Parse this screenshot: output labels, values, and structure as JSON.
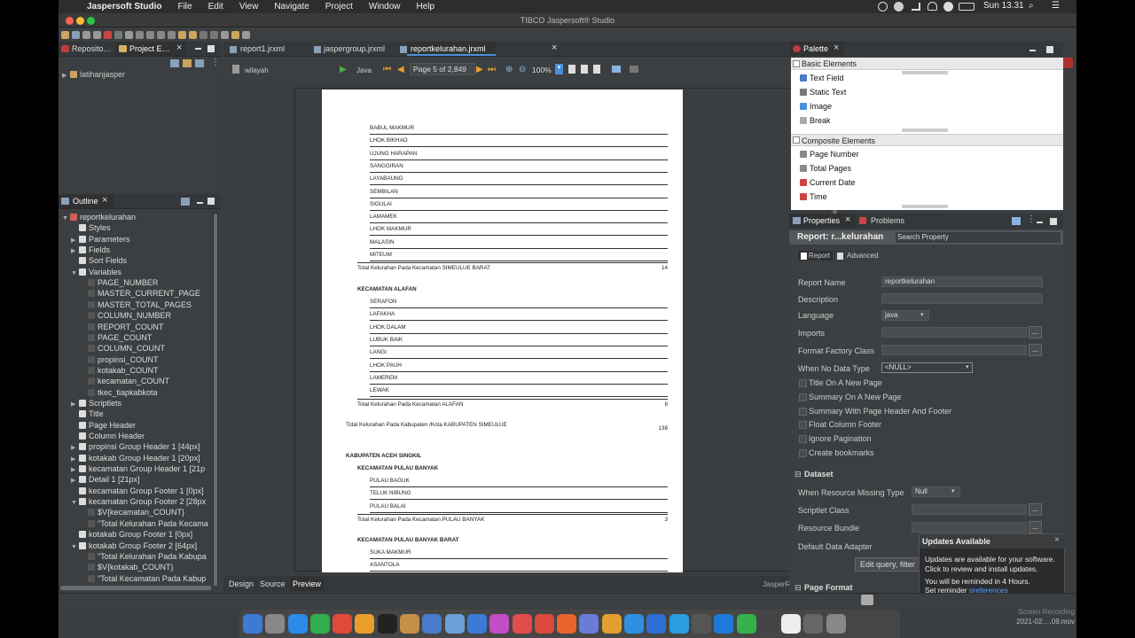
{
  "menubar": {
    "app": "Jaspersoft Studio",
    "items": [
      "File",
      "Edit",
      "View",
      "Navigate",
      "Project",
      "Window",
      "Help"
    ],
    "clock": "Sun 13.31"
  },
  "window_title": "TIBCO Jaspersoft® Studio",
  "left_tabs": {
    "repo": "Reposito…",
    "project": "Project E…"
  },
  "project_tree": {
    "root": "latihanjasper"
  },
  "outline": {
    "tab": "Outline",
    "items": [
      {
        "label": "reportkelurahan",
        "level": 0,
        "arrow": "▼"
      },
      {
        "label": "Styles",
        "level": 1,
        "arrow": ""
      },
      {
        "label": "Parameters",
        "level": 1,
        "arrow": "▶"
      },
      {
        "label": "Fields",
        "level": 1,
        "arrow": "▶"
      },
      {
        "label": "Sort Fields",
        "level": 1,
        "arrow": ""
      },
      {
        "label": "Variables",
        "level": 1,
        "arrow": "▼"
      },
      {
        "label": "PAGE_NUMBER",
        "level": 2,
        "arrow": ""
      },
      {
        "label": "MASTER_CURRENT_PAGE",
        "level": 2,
        "arrow": ""
      },
      {
        "label": "MASTER_TOTAL_PAGES",
        "level": 2,
        "arrow": ""
      },
      {
        "label": "COLUMN_NUMBER",
        "level": 2,
        "arrow": ""
      },
      {
        "label": "REPORT_COUNT",
        "level": 2,
        "arrow": ""
      },
      {
        "label": "PAGE_COUNT",
        "level": 2,
        "arrow": ""
      },
      {
        "label": "COLUMN_COUNT",
        "level": 2,
        "arrow": ""
      },
      {
        "label": "propinsi_COUNT",
        "level": 2,
        "arrow": ""
      },
      {
        "label": "kotakab_COUNT",
        "level": 2,
        "arrow": ""
      },
      {
        "label": "kecamatan_COUNT",
        "level": 2,
        "arrow": ""
      },
      {
        "label": "tkec_tiapkabkota",
        "level": 2,
        "arrow": ""
      },
      {
        "label": "Scriptlets",
        "level": 1,
        "arrow": "▶"
      },
      {
        "label": "Title",
        "level": 1,
        "arrow": ""
      },
      {
        "label": "Page Header",
        "level": 1,
        "arrow": ""
      },
      {
        "label": "Column Header",
        "level": 1,
        "arrow": ""
      },
      {
        "label": "propinsi Group Header 1 [44px]",
        "level": 1,
        "arrow": "▶"
      },
      {
        "label": "kotakab Group Header 1 [20px]",
        "level": 1,
        "arrow": "▶"
      },
      {
        "label": "kecamatan Group Header 1 [21p",
        "level": 1,
        "arrow": "▶"
      },
      {
        "label": "Detail 1 [21px]",
        "level": 1,
        "arrow": "▶"
      },
      {
        "label": "kecamatan Group Footer 1 [0px]",
        "level": 1,
        "arrow": ""
      },
      {
        "label": "kecamatan Group Footer 2 [28px",
        "level": 1,
        "arrow": "▼"
      },
      {
        "label": "$V{kecamatan_COUNT}",
        "level": 2,
        "arrow": ""
      },
      {
        "label": "\"Total Kelurahan Pada Kecama",
        "level": 2,
        "arrow": ""
      },
      {
        "label": "kotakab Group Footer 1 [0px]",
        "level": 1,
        "arrow": ""
      },
      {
        "label": "kotakab Group Footer 2 [64px]",
        "level": 1,
        "arrow": "▼"
      },
      {
        "label": "\"Total Kelurahan Pada Kabupa",
        "level": 2,
        "arrow": ""
      },
      {
        "label": "$V{kotakab_COUNT}",
        "level": 2,
        "arrow": ""
      },
      {
        "label": "\"Total Kecamatan Pada Kabup",
        "level": 2,
        "arrow": ""
      }
    ]
  },
  "editor": {
    "tabs": [
      "report1.jrxml",
      "jaspergroup.jrxml",
      "reportkelurahan.jrxml"
    ],
    "dataset": "wilayah",
    "language": "Java",
    "page_indicator": "Page 5 of 2,849",
    "zoom": "100%",
    "bottom_tabs": [
      "Design",
      "Source",
      "Preview"
    ],
    "library": "JasperReports Library"
  },
  "report": {
    "group1_rows": [
      "BABUL MAKMUR",
      "LHOK BIKHAO",
      "UJUNG HARAPAN",
      "SANGGIRAN",
      "LAYABAUNG",
      "SEMBILAN",
      "SIGULAI",
      "LAMAMEK",
      "LHOK MAKMUR",
      "MALASIN",
      "MITEUM"
    ],
    "total1": "Total Kelurahan Pada Kecamatan SIMEULUE BARAT",
    "total1_n": "14",
    "kec2": "KECAMATAN ALAFAN",
    "group2_rows": [
      "SERAFON",
      "LAFAKHA",
      "LHOK DALAM",
      "LUBUK BAIK",
      "LANGI",
      "LHOK PAUH",
      "LAMEREM",
      "LEWAK"
    ],
    "total2": "Total Kelurahan Pada Kecamatan ALAFAN",
    "total2_n": "8",
    "kab_total": "Total Kelurahan Pada Kabupaten /Kota  KABUPATEN SIMEULUE",
    "kab_total_n": "138",
    "kab2": "KABUPATEN ACEH SINGKIL",
    "kec3": "KECAMATAN PULAU BANYAK",
    "group3_rows": [
      "PULAU BAGUK",
      "TELUK NIBUNG",
      "PULAU BALAI"
    ],
    "total3": "Total Kelurahan Pada Kecamatan PULAU BANYAK",
    "total3_n": "3",
    "kec4": "KECAMATAN PULAU BANYAK BARAT",
    "group4_rows": [
      "SUKA MAKMUR",
      "ASANTOLA"
    ]
  },
  "palette": {
    "tab": "Palette",
    "basic_header": "Basic Elements",
    "basic": [
      "Text Field",
      "Static Text",
      "Image",
      "Break"
    ],
    "composite_header": "Composite Elements",
    "composite": [
      "Page Number",
      "Total Pages",
      "Current Date",
      "Time"
    ]
  },
  "properties": {
    "tab": "Properties",
    "problems_tab": "Problems",
    "title": "Report: r...kelurahan",
    "search_placeholder": "Search Property",
    "subtab_report": "Report",
    "subtab_advanced": "Advanced",
    "report_name_label": "Report Name",
    "report_name": "reportkelurahan",
    "description_label": "Description",
    "language_label": "Language",
    "language": "java",
    "imports_label": "Imports",
    "format_factory_label": "Format Factory Class",
    "when_no_data_label": "When No Data Type",
    "when_no_data": "<NULL>",
    "checkboxes": [
      "Title On A New Page",
      "Summary On A New Page",
      "Summary With Page Header And Footer",
      "Float Column Footer",
      "Ignore Pagination",
      "Create bookmarks"
    ],
    "dataset_header": "Dataset",
    "resource_missing_label": "When Resource Missing Type",
    "resource_missing": "Null",
    "scriptlet_label": "Scriptlet Class",
    "resource_bundle_label": "Resource Bundle",
    "data_adapter_label": "Default Data Adapter",
    "edit_query_btn": "Edit query, filter",
    "page_format_header": "Page Format",
    "dots": "..."
  },
  "notification": {
    "title": "Updates Available",
    "line1": "Updates are available for your software.",
    "line2": "Click to review and install updates.",
    "line3": "You will be reminded in 4 Hours.",
    "line4_prefix": "Set reminder ",
    "line4_link": "preferences",
    "close": "×"
  },
  "recording": {
    "line1": "Screen Recording",
    "line2": "2021-02….09.mov"
  },
  "colors": {
    "dock_icons": [
      "#3b7bd6",
      "#888",
      "#2b8be6",
      "#2fae4b",
      "#e04a3b",
      "#e8a02a",
      "#222",
      "#c58f4a",
      "#4a7cc7",
      "#6aa0d8",
      "#3a7bd6",
      "#c44cc4",
      "#e34c4c",
      "#d94a3a",
      "#e8642c",
      "#6a7bd8",
      "#e0a030",
      "#2f8fe0",
      "#2e6fd6",
      "#2a9de0",
      "#555",
      "#1e7ad8",
      "#35b24a",
      "#444",
      "#eee",
      "#666",
      "#888"
    ]
  }
}
